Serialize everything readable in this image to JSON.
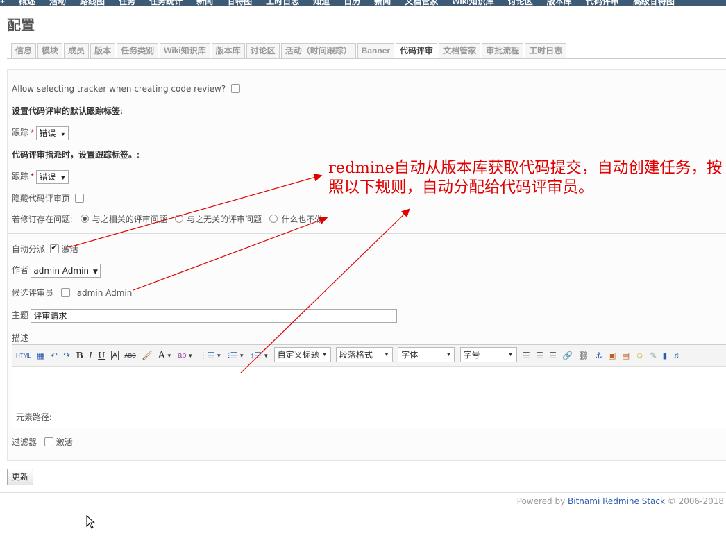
{
  "top_menu": [
    "+",
    "概述",
    "活动",
    "路线图",
    "任务",
    "任务统计",
    "新闻",
    "甘特图",
    "工时日志",
    "知道",
    "日历",
    "新闻",
    "文档管家",
    "Wiki知识库",
    "讨论区",
    "版本库",
    "代码评审",
    "高级甘特图"
  ],
  "page_title": "配置",
  "tabs": [
    "信息",
    "模块",
    "成员",
    "版本",
    "任务类别",
    "Wiki知识库",
    "版本库",
    "讨论区",
    "活动（时间跟踪）",
    "Banner",
    "代码评审",
    "文档管家",
    "审批流程",
    "工时日志"
  ],
  "active_tab": "代码评审",
  "form": {
    "allow_tracker_label": "Allow selecting tracker when creating code review?",
    "default_tracker_heading": "设置代码评审的默认跟踪标签:",
    "tracker_label": "跟踪",
    "required_mark": "*",
    "tracker_value": "错误",
    "assign_tracker_heading": "代码评审指派时，设置跟踪标签。:",
    "tracker2_label": "跟踪",
    "tracker2_value": "错误",
    "hide_review_tab_label": "隐藏代码评审页",
    "if_revision_label": "若修订存在问题:",
    "radio_related": "与之相关的评审问题",
    "radio_unrelated": "与之无关的评审问题",
    "radio_nothing": "什么也不做",
    "auto_assign_label": "自动分派",
    "activate_label": "激活",
    "author_label": "作者",
    "author_value": "admin Admin",
    "candidate_label": "候选评审员",
    "candidate_name": "admin Admin",
    "subject_label": "主题",
    "subject_value": "评审请求",
    "description_label": "描述",
    "filter_label": "过滤器",
    "filter_activate_label": "激活"
  },
  "editor": {
    "html_btn": "HTML",
    "bold": "B",
    "italic": "I",
    "underline": "U",
    "strike": "ABC",
    "font_color": "A",
    "custom_heading": "自定义标题",
    "paragraph_format": "段落格式",
    "font_family": "字体",
    "font_size": "字号",
    "path_label": "元素路径:"
  },
  "submit_button": "更新",
  "footer": {
    "powered_by": "Powered by ",
    "link": "Bitnami Redmine Stack",
    "copyright": " © 2006-2018"
  },
  "annotation": "redmine自动从版本库获取代码提交，自动创建任务，按照以下规则，自动分配给代码评审员。",
  "colors": {
    "annotation": "#e00000",
    "topbar": "#3e5b76",
    "link": "#2a5db0"
  }
}
